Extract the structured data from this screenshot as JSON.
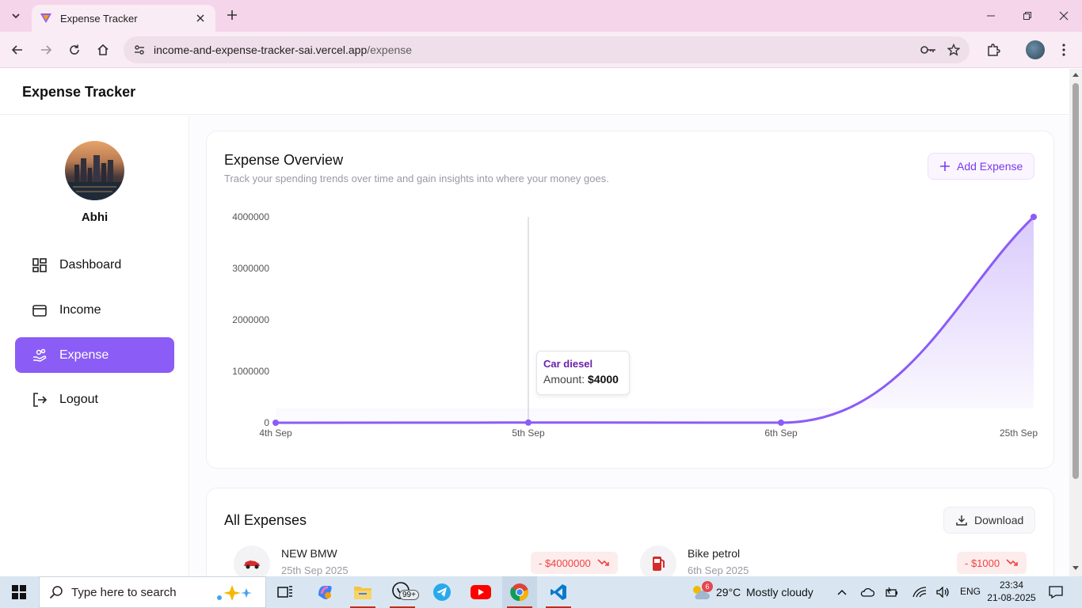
{
  "browser": {
    "tab_title": "Expense Tracker",
    "url_host": "income-and-expense-tracker-sai.vercel.app",
    "url_path": "/expense"
  },
  "app": {
    "title": "Expense Tracker",
    "user_name": "Abhi",
    "nav": [
      {
        "label": "Dashboard",
        "icon": "dashboard-icon"
      },
      {
        "label": "Income",
        "icon": "wallet-icon"
      },
      {
        "label": "Expense",
        "icon": "hand-coins-icon",
        "active": true
      },
      {
        "label": "Logout",
        "icon": "logout-icon"
      }
    ],
    "accent": "#8b5cf6"
  },
  "overview": {
    "title": "Expense Overview",
    "subtitle": "Track your spending trends over time and gain insights into where your money goes.",
    "add_button": "Add Expense",
    "tooltip": {
      "name": "Car diesel",
      "amount_label": "Amount:",
      "amount_value": "$4000"
    }
  },
  "chart_data": {
    "type": "area",
    "categories": [
      "4th Sep",
      "5th Sep",
      "6th Sep",
      "25th Sep"
    ],
    "values": [
      0,
      4000,
      1000,
      4000000
    ],
    "y_ticks": [
      "0",
      "1000000",
      "2000000",
      "3000000",
      "4000000"
    ],
    "ylim": [
      0,
      4000000
    ],
    "grid": false,
    "color": "#8b5cf6"
  },
  "all_expenses": {
    "title": "All Expenses",
    "download_button": "Download",
    "items": [
      {
        "name": "NEW BMW",
        "date": "25th Sep 2025",
        "amount": "- $4000000",
        "icon": "car-icon"
      },
      {
        "name": "Bike petrol",
        "date": "6th Sep 2025",
        "amount": "- $1000",
        "icon": "fuel-pump-icon"
      }
    ]
  },
  "taskbar": {
    "search_placeholder": "Type here to search",
    "whatsapp_badge": "99+",
    "weather_badge": "6",
    "weather_temp": "29°C",
    "weather_desc": "Mostly cloudy",
    "language": "ENG",
    "time": "23:34",
    "date": "21-08-2025"
  }
}
